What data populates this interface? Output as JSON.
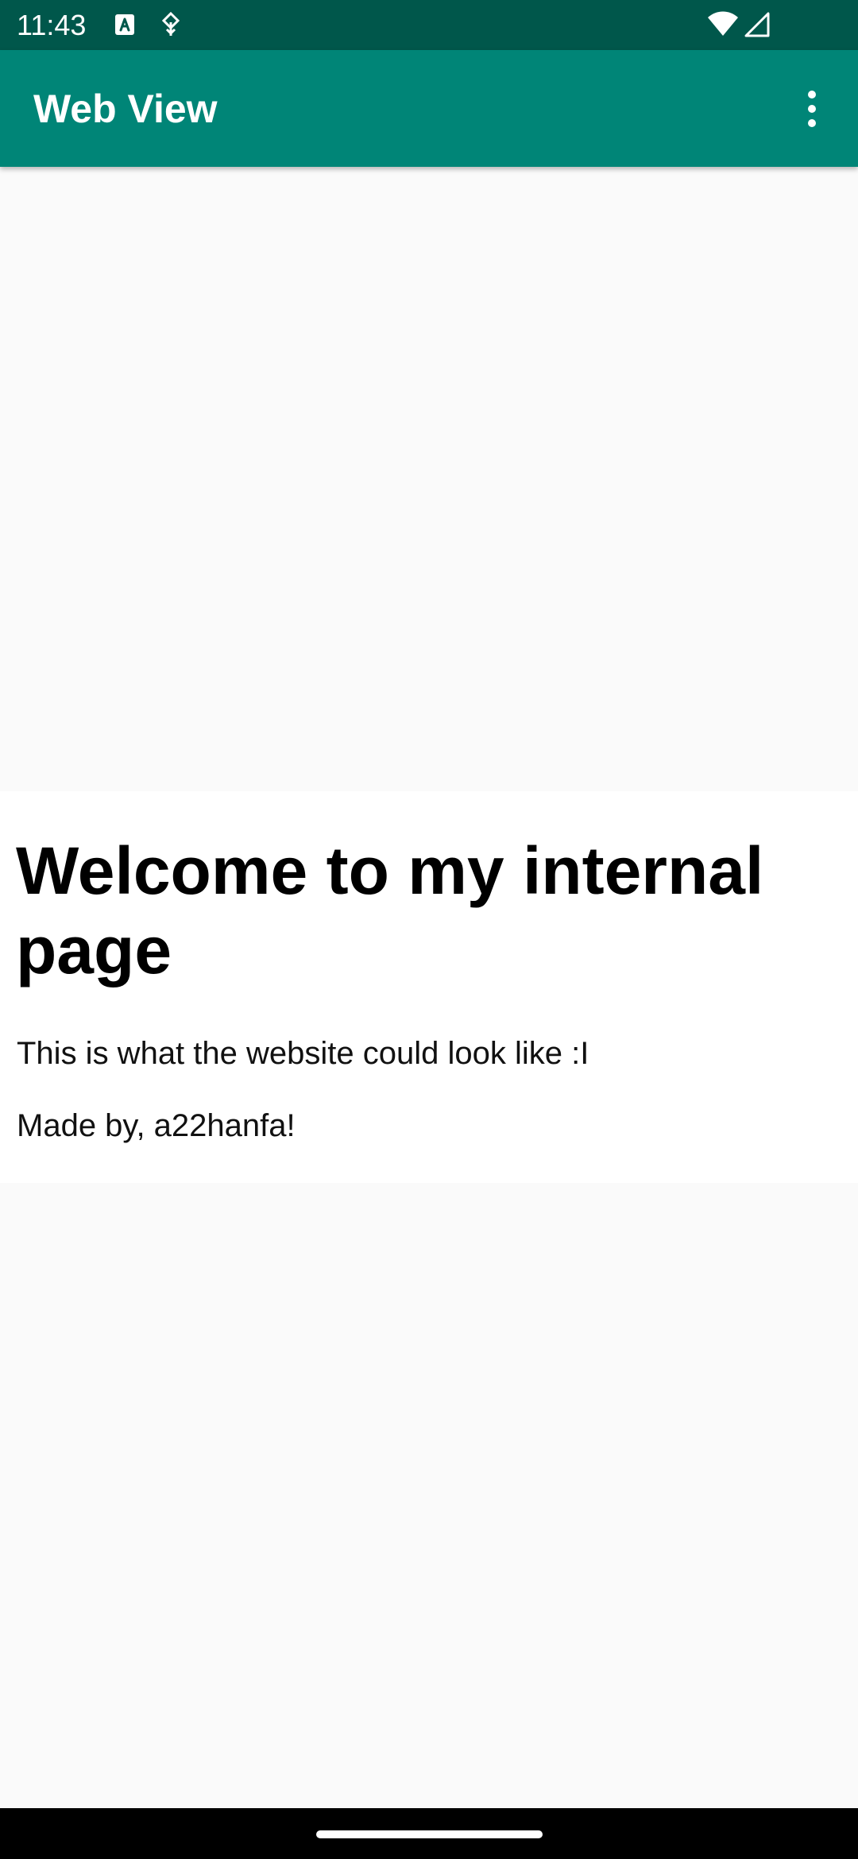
{
  "status_bar": {
    "time": "11:43",
    "background": "#00574b",
    "icons": [
      "keyboard-a-icon",
      "navigation-icon",
      "wifi-icon",
      "signal-icon"
    ]
  },
  "app_bar": {
    "title": "Web View",
    "background": "#008577",
    "menu_icon": "overflow-menu-icon"
  },
  "web_content": {
    "heading": "Welcome to my internal page",
    "paragraphs": [
      "This is what the website could look like :I",
      "Made by, a22hanfa!"
    ]
  },
  "colors": {
    "content_background": "#fafafa",
    "card_background": "#ffffff",
    "nav_bar": "#000000"
  }
}
